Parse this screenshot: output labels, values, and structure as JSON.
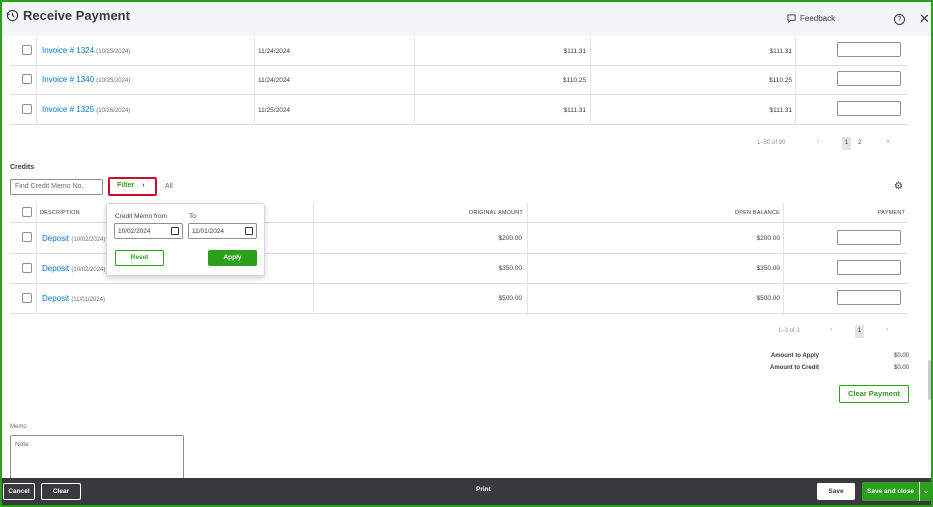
{
  "header": {
    "title": "Receive Payment",
    "feedback_label": "Feedback",
    "help_glyph": "?",
    "close_glyph": "✕"
  },
  "invoices": {
    "rows": [
      {
        "label": "Invoice # 1324",
        "date": "(10/25/2024)",
        "due": "11/24/2024",
        "original": "$111.31",
        "open": "$111.31"
      },
      {
        "label": "Invoice # 1340",
        "date": "(10/25/2024)",
        "due": "11/24/2024",
        "original": "$110.25",
        "open": "$110.25"
      },
      {
        "label": "Invoice # 1325",
        "date": "(10/26/2024)",
        "due": "11/25/2024",
        "original": "$111.31",
        "open": "$111.31"
      }
    ],
    "pager": {
      "range": "1–50 of 90",
      "prev": "‹",
      "page1": "1",
      "page2": "2",
      "next": "›"
    }
  },
  "credits": {
    "section_title": "Credits",
    "search_placeholder": "Find Credit Memo No.",
    "filter_label": "Filter",
    "all_label": "All",
    "columns": {
      "description": "DESCRIPTION",
      "original": "ORIGINAL AMOUNT",
      "open": "OPEN BALANCE",
      "payment": "PAYMENT"
    },
    "rows": [
      {
        "label": "Deposit",
        "date": "(10/02/2024)",
        "original": "$200.00",
        "open": "$200.00"
      },
      {
        "label": "Deposit",
        "date": "(10/02/2024)",
        "original": "$350.00",
        "open": "$350.00"
      },
      {
        "label": "Deposit",
        "date": "(11/01/2024)",
        "original": "$500.00",
        "open": "$500.00"
      }
    ],
    "pager": {
      "range": "1–3 of 3",
      "prev": "‹",
      "page1": "1",
      "next": "›"
    }
  },
  "filter_popup": {
    "from_label": "Credit Memo from",
    "to_label": "To",
    "from_value": "10/02/2024",
    "to_value": "11/01/2024",
    "reset_label": "Reset",
    "apply_label": "Apply"
  },
  "summary": {
    "amount_to_apply_label": "Amount to Apply",
    "amount_to_apply": "$0.00",
    "amount_to_credit_label": "Amount to Credit",
    "amount_to_credit": "$0.00",
    "clear_payment_label": "Clear Payment"
  },
  "memo": {
    "label": "Memo",
    "placeholder": "Note"
  },
  "footer": {
    "cancel_label": "Cancel",
    "clear_label": "Clear",
    "print_label": "Print",
    "save_label": "Save",
    "save_close_label": "Save and close",
    "dropdown_glyph": "⌄"
  },
  "colors": {
    "brand_green": "#2ca01c",
    "highlight_red": "#c8102e",
    "footer_bg": "#393a3d",
    "link_blue": "#0077c5"
  }
}
